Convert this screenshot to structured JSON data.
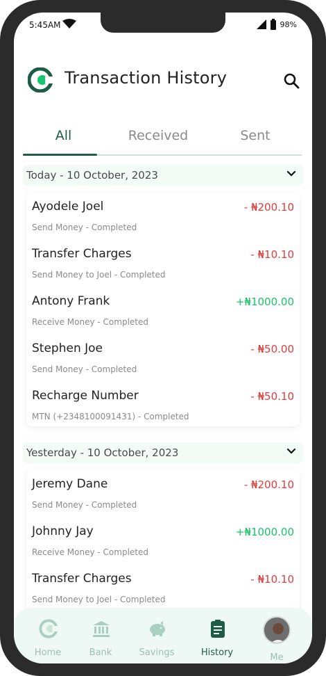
{
  "status_bar": {
    "time": "5:45AM",
    "battery": "98%"
  },
  "header": {
    "title": "Transaction History"
  },
  "tabs": [
    {
      "label": "All"
    },
    {
      "label": "Received"
    },
    {
      "label": "Sent"
    }
  ],
  "sections": [
    {
      "label": "Today - 10 October, 2023",
      "transactions": [
        {
          "name": "Ayodele Joel",
          "subtitle": "Send Money - Completed",
          "amount": "- ₦200.10",
          "type": "debit"
        },
        {
          "name": "Transfer Charges",
          "subtitle": "Send Money to Joel - Completed",
          "amount": "- ₦10.10",
          "type": "debit"
        },
        {
          "name": "Antony Frank",
          "subtitle": "Receive Money - Completed",
          "amount": "+₦1000.00",
          "type": "credit"
        },
        {
          "name": "Stephen Joe",
          "subtitle": "Send Money - Completed",
          "amount": "- ₦50.00",
          "type": "debit"
        },
        {
          "name": "Recharge Number",
          "subtitle": "MTN (+2348100091431) - Completed",
          "amount": "- ₦50.10",
          "type": "debit"
        }
      ]
    },
    {
      "label": "Yesterday - 10 October, 2023",
      "transactions": [
        {
          "name": "Jeremy Dane",
          "subtitle": "Send Money - Completed",
          "amount": "- ₦200.10",
          "type": "debit"
        },
        {
          "name": "Johnny Jay",
          "subtitle": "Receive Money - Completed",
          "amount": "+₦1000.00",
          "type": "credit"
        },
        {
          "name": "Transfer Charges",
          "subtitle": "Send Money to Joel - Completed",
          "amount": "- ₦10.10",
          "type": "debit"
        }
      ]
    }
  ],
  "bottom_nav": [
    {
      "label": "Home",
      "icon": "logo-icon"
    },
    {
      "label": "Bank",
      "icon": "bank-icon"
    },
    {
      "label": "Savings",
      "icon": "piggy-bank-icon"
    },
    {
      "label": "History",
      "icon": "clipboard-icon"
    },
    {
      "label": "Me",
      "icon": "avatar"
    }
  ],
  "colors": {
    "brand": "#1f5c45",
    "accent": "#19c46b",
    "debit": "#e53a3a",
    "credit": "#19c46b"
  }
}
